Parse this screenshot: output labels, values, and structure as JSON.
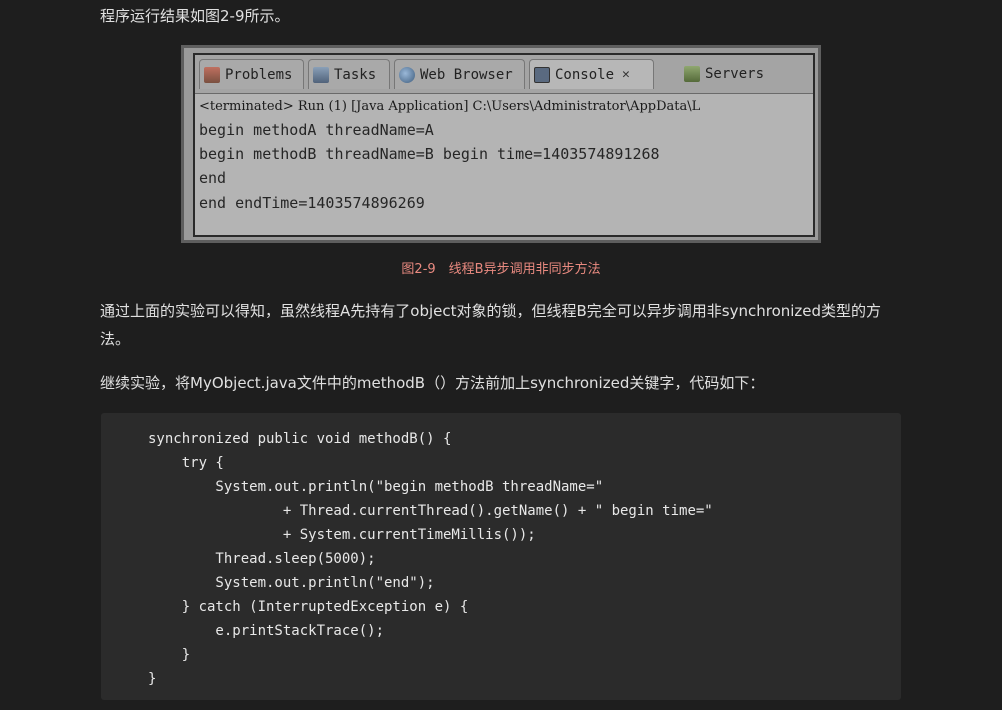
{
  "intro": "程序运行结果如图2-9所示。",
  "screenshot": {
    "tabs": [
      {
        "label": "Problems",
        "icon": "problems-icon"
      },
      {
        "label": "Tasks",
        "icon": "tasks-icon"
      },
      {
        "label": "Web Browser",
        "icon": "web-browser-icon"
      },
      {
        "label": "Console",
        "icon": "console-icon",
        "close": "✕"
      },
      {
        "label": "Servers",
        "icon": "servers-icon"
      }
    ],
    "status_line": "<terminated> Run (1) [Java Application] C:\\Users\\Administrator\\AppData\\L",
    "console_lines": [
      "begin methodA threadName=A",
      "begin methodB threadName=B begin time=1403574891268",
      "end",
      "end endTime=1403574896269"
    ]
  },
  "caption": "图2-9　线程B异步调用非同步方法",
  "paragraph1": "通过上面的实验可以得知，虽然线程A先持有了object对象的锁，但线程B完全可以异步调用非synchronized类型的方法。",
  "paragraph2": "继续实验，将MyObject.java文件中的methodB（）方法前加上synchronized关键字，代码如下：",
  "code": "synchronized public void methodB() {\n    try {\n        System.out.println(\"begin methodB threadName=\"\n                + Thread.currentThread().getName() + \" begin time=\"\n                + System.currentTimeMillis());\n        Thread.sleep(5000);\n        System.out.println(\"end\");\n    } catch (InterruptedException e) {\n        e.printStackTrace();\n    }\n}"
}
